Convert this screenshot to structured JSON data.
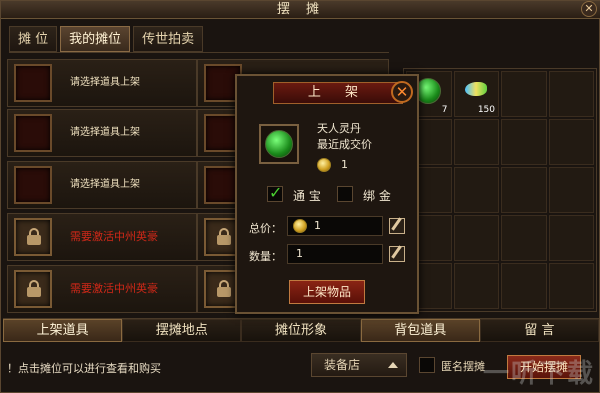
{
  "window": {
    "title": "摆 摊",
    "close_icon": "close-icon"
  },
  "tabs": [
    {
      "label": "摊 位",
      "active": false
    },
    {
      "label": "我的摊位",
      "active": true
    },
    {
      "label": "传世拍卖",
      "active": false
    }
  ],
  "slots_left": [
    {
      "text": "请选择道具上架",
      "locked": false
    },
    {
      "text": "请选择道具上架",
      "locked": false
    },
    {
      "text": "请选择道具上架",
      "locked": false
    },
    {
      "text": "需要激活中州英豪",
      "locked": true
    },
    {
      "text": "需要激活中州英豪",
      "locked": true
    }
  ],
  "inventory": [
    {
      "icon": "green-pill-icon",
      "qty": "7"
    },
    {
      "icon": "bird-icon",
      "qty": "150"
    }
  ],
  "bottom_tabs": [
    {
      "label": "上架道具",
      "active": true
    },
    {
      "label": "摆摊地点",
      "active": false
    },
    {
      "label": "摊位形象",
      "active": false
    },
    {
      "label": "背包道具",
      "active": true
    },
    {
      "label": "留 言",
      "active": false
    }
  ],
  "footer": {
    "note": "！点击摊位可以进行查看和购买",
    "dropdown_value": "装备店",
    "anon_label": "匿名摆摊",
    "start_button": "开始摆摊",
    "watermark": "一听下载"
  },
  "popup": {
    "title": "上 架",
    "item_name": "天人灵丹",
    "recent_label": "最近成交价",
    "recent_price": "1",
    "currency_tongbao": "通 宝",
    "currency_bangjin": "绑 金",
    "tongbao_checked": true,
    "total_label": "总价：",
    "total_value": "1",
    "qty_label": "数量：",
    "qty_value": "1",
    "submit": "上架物品"
  }
}
